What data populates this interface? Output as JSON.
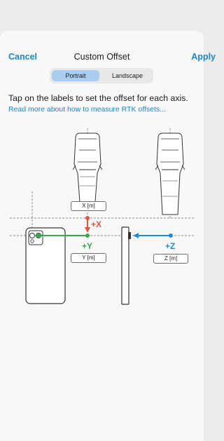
{
  "nav": {
    "cancel_label": "Cancel",
    "title": "Custom Offset",
    "apply_label": "Apply"
  },
  "orientation": {
    "options": [
      "Portrait",
      "Landscape"
    ],
    "selected": "Portrait"
  },
  "instructions": "Tap on the labels to set the offset for each axis.",
  "help_link": "Read more about how to measure RTK offsets...",
  "axes": {
    "x": {
      "field_label": "X [m]",
      "direction": "+X"
    },
    "y": {
      "field_label": "Y [m]",
      "direction": "+Y"
    },
    "z": {
      "field_label": "Z [m]",
      "direction": "+Z"
    }
  },
  "colors": {
    "accent": "#1a86c8",
    "segment_selected": "#a9cdf0",
    "axis_x": "#e5533d",
    "axis_y": "#35a64a",
    "axis_z": "#1c8ad6"
  },
  "icons": [
    "rtk-receiver-front-icon",
    "rtk-receiver-side-icon",
    "phone-back-icon",
    "phone-side-icon"
  ]
}
